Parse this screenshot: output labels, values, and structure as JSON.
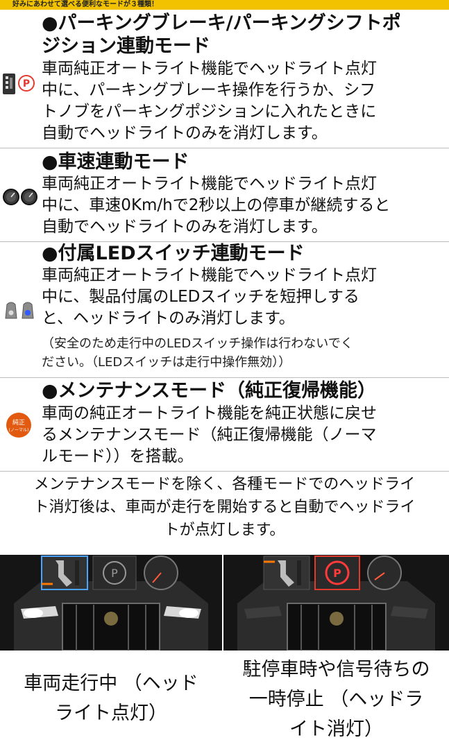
{
  "banner": "好みにあわせて選べる便利なモードが３種類！",
  "sections": [
    {
      "title_line1": "●パーキングブレーキ/パーキングシフトポ",
      "title_line2": "ジション連動モード",
      "body_lines": [
        "車両純正オートライト機能でヘッドライト点灯",
        "中に、パーキングブレーキ操作を行うか、シフ",
        "トノブをパーキングポジションに入れたときに",
        "自動でヘッドライトのみを消灯します。"
      ],
      "icon": "parking-brake-shift-icon",
      "icon_label": "P"
    },
    {
      "title_line1": "●車速連動モード",
      "body_lines": [
        "車両純正オートライト機能でヘッドライト点灯",
        "中に、車速0Km/hで2秒以上の停車が継続すると",
        "自動でヘッドライトのみを消灯します。"
      ],
      "icon": "speedometer-icon"
    },
    {
      "title_line1": "●付属LEDスイッチ連動モード",
      "body_lines": [
        "車両純正オートライト機能でヘッドライト点灯",
        "中に、製品付属のLEDスイッチを短押しする",
        "と、ヘッドライトのみ消灯します。"
      ],
      "note_lines": [
        "（安全のため走行中のLEDスイッチ操作は行わないでく",
        "ださい。（LEDスイッチは走行中操作無効））"
      ],
      "icon": "led-switch-icon"
    },
    {
      "title_line1": "●メンテナンスモード（純正復帰機能）",
      "body_lines": [
        "車両の純正オートライト機能を純正状態に戻せ",
        "るメンテナンスモード（純正復帰機能（ノーマ",
        "ルモード））を搭載。"
      ],
      "icon": "maintenance-badge-icon",
      "icon_label_1": "純正",
      "icon_label_2": "(ノーマル)"
    }
  ],
  "bottom_note_lines": [
    "メンテナンスモードを除く、各種モードでのヘッドライ",
    "ト消灯後は、車両が走行を開始すると自動でヘッドライ",
    "トが点灯します。"
  ],
  "captions": {
    "left_line1": "車両走行中 （ヘッド",
    "left_line2": "ライト点灯）",
    "right_line1": "駐停車時や信号待ちの",
    "right_line2": "一時停止 （ヘッドラ",
    "right_line3": "イト消灯）"
  },
  "colors": {
    "banner": "#f2c200",
    "parking_red": "#e23b2e",
    "led_blue": "#2f5bff",
    "maintenance_orange": "#e25a10"
  }
}
